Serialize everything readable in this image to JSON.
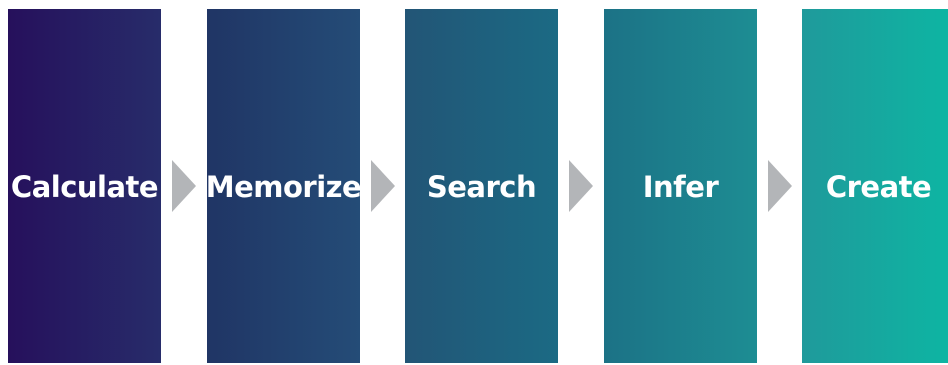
{
  "diagram": {
    "steps": [
      {
        "label": "Calculate"
      },
      {
        "label": "Memorize"
      },
      {
        "label": "Search"
      },
      {
        "label": "Infer"
      },
      {
        "label": "Create"
      }
    ],
    "colors": {
      "arrow": "#b3b5b8",
      "text": "#ffffff",
      "gradient_start": "#26105c",
      "gradient_end": "#0db6a3"
    }
  }
}
